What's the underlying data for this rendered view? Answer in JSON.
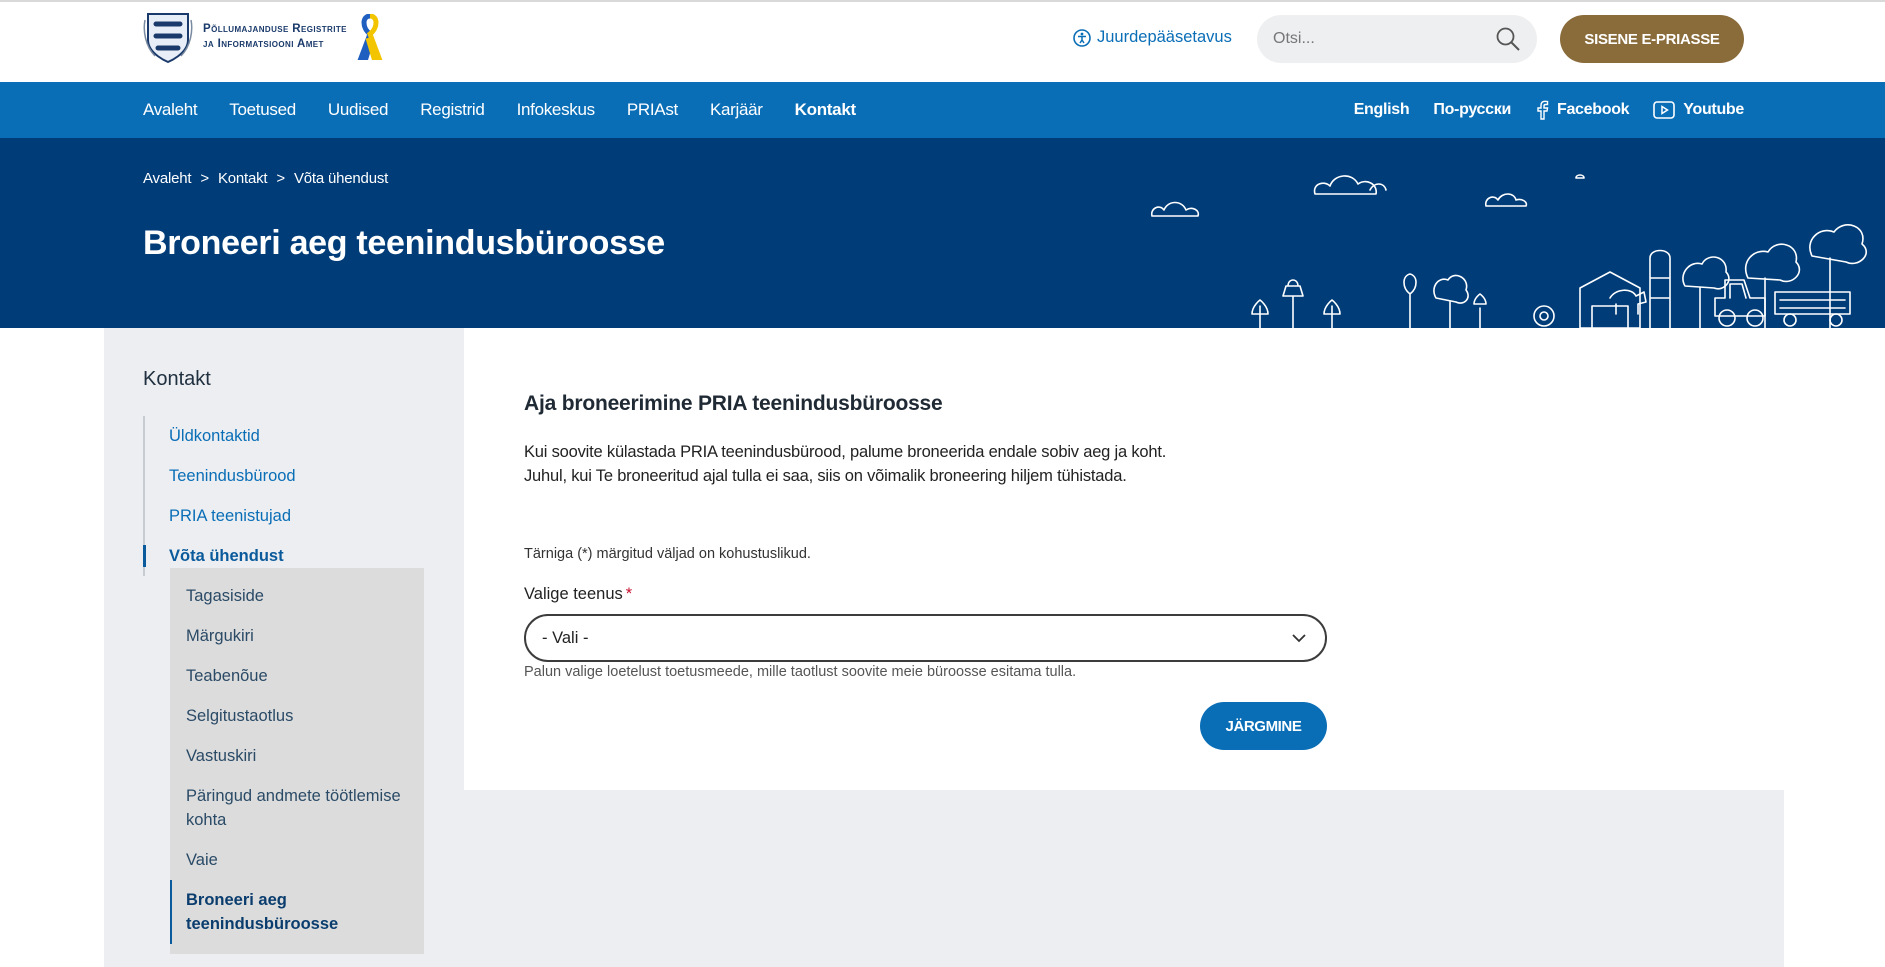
{
  "header": {
    "org_line1": "Põllumajanduse Registrite",
    "org_line2": "ja Informatsiooni Amet",
    "accessibility_link": "Juurdepääsetavus",
    "search_placeholder": "Otsi...",
    "login_button": "SISENE E-PRIASSE"
  },
  "nav": {
    "main": [
      "Avaleht",
      "Toetused",
      "Uudised",
      "Registrid",
      "Infokeskus",
      "PRIAst",
      "Karjäär",
      "Kontakt"
    ],
    "active": "Kontakt",
    "right": {
      "english": "English",
      "russian": "По-русски",
      "facebook": "Facebook",
      "youtube": "Youtube"
    }
  },
  "hero": {
    "breadcrumb": [
      "Avaleht",
      "Kontakt",
      "Võta ühendust"
    ],
    "breadcrumb_separator": ">",
    "title": "Broneeri aeg teenindusbüroosse"
  },
  "sidebar": {
    "title": "Kontakt",
    "items": [
      "Üldkontaktid",
      "Teenindusbürood",
      "PRIA teenistujad",
      "Võta ühendust"
    ],
    "active_item": "Võta ühendust",
    "sub_items": [
      "Tagasiside",
      "Märgukiri",
      "Teabenõue",
      "Selgitustaotlus",
      "Vastuskiri",
      "Päringud andmete töötlemise kohta",
      "Vaie",
      "Broneeri aeg teenindusbüroosse"
    ],
    "current_sub_item": "Broneeri aeg teenindusbüroosse"
  },
  "form": {
    "title": "Aja broneerimine PRIA teenindusbüroosse",
    "intro_line1": "Kui soovite külastada PRIA teenindusbürood, palume broneerida endale sobiv aeg ja koht.",
    "intro_line2": "Juhul, kui Te broneeritud ajal tulla ei saa, siis on võimalik broneering hiljem tühistada.",
    "required_note": "Tärniga (*) märgitud väljad on kohustuslikud.",
    "service_label": "Valige teenus",
    "required_mark": "*",
    "service_selected": "- Vali -",
    "service_help": "Palun valige loetelust toetusmeede, mille taotlust soovite meie büroosse esitama tulla.",
    "next_button": "JÄRGMINE"
  },
  "colors": {
    "nav_blue": "#0a6eb7",
    "hero_navy": "#003c78",
    "login_gold": "#8a6c3b",
    "required_red": "#c8102e"
  }
}
